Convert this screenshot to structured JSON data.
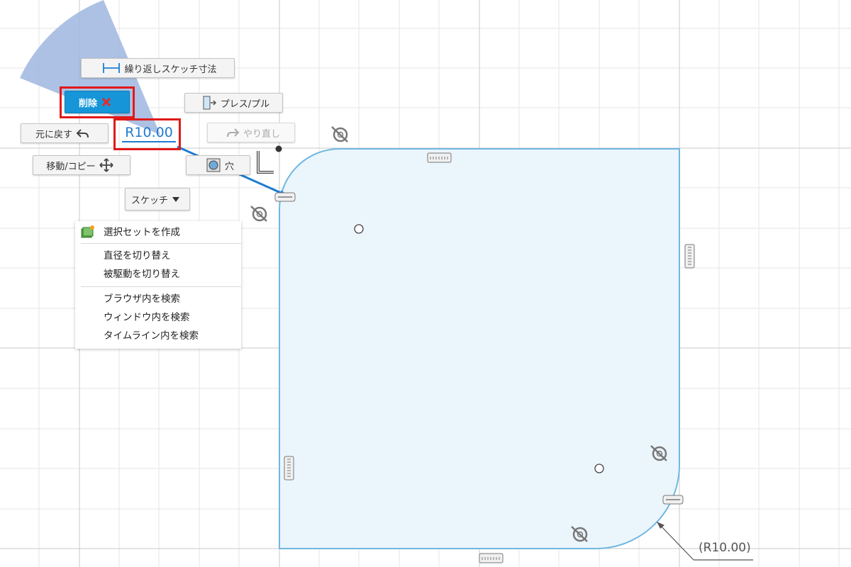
{
  "marking_menu": {
    "repeat_dimension": "繰り返しスケッチ寸法",
    "delete": "削除",
    "press_pull": "プレス/プル",
    "undo": "元に戻す",
    "redo": "やり直し",
    "move_copy": "移動/コピー",
    "hole": "穴",
    "sketch_dropdown": "スケッチ"
  },
  "dimension_input": {
    "value": "R10.00"
  },
  "context_menu": {
    "groups": [
      [
        "選択セットを作成"
      ],
      [
        "直径を切り替え",
        "被駆動を切り替え"
      ],
      [
        "ブラウザ内を検索",
        "ウィンドウ内を検索",
        "タイムライン内を検索"
      ]
    ]
  },
  "sketch_dimension": {
    "label": "(R10.00)"
  },
  "icons": {
    "repeat_dimension": "dimension-icon",
    "delete": "close-x-icon",
    "press_pull": "press-pull-icon",
    "undo": "undo-arrow-icon",
    "redo": "redo-arrow-icon",
    "move_copy": "move-arrows-icon",
    "hole": "hole-icon",
    "sketch": "chevron-down-icon",
    "selection_set": "selection-set-icon",
    "tangent": "tangent-constraint-icon",
    "horizontal": "horizontal-constraint-icon",
    "vertical": "vertical-constraint-icon",
    "perpendicular": "perpendicular-constraint-icon"
  },
  "colors": {
    "accent": "#1696d8",
    "dimension_text": "#1f7cd2",
    "highlight": "#e01919",
    "sketch_line": "#6fb8e0",
    "sketch_fill": "#ebf5fc",
    "sector": "#9fb6df"
  }
}
